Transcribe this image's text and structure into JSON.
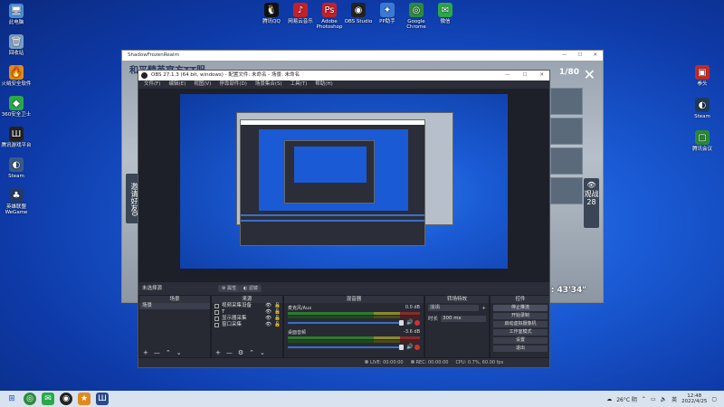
{
  "desktop": {
    "left_icons": [
      {
        "label": "此电脑",
        "glyph": "🖥",
        "color": "#4a90d9"
      },
      {
        "label": "回收站",
        "glyph": "🗑",
        "color": "#7aa0c8"
      },
      {
        "label": "火绒安全软件",
        "glyph": "🔥",
        "color": "#e08a1e"
      },
      {
        "label": "360安全卫士",
        "glyph": "◆",
        "color": "#2aa84a"
      },
      {
        "label": "腾讯游戏平台",
        "glyph": "Ш",
        "color": "#222"
      },
      {
        "label": "Steam",
        "glyph": "◐",
        "color": "#3a5a88"
      },
      {
        "label": "英雄联盟WeGame",
        "glyph": "♣",
        "color": "#233a6b"
      }
    ],
    "top_icons": [
      {
        "label": "腾讯QQ",
        "glyph": "🐧",
        "color": "#111"
      },
      {
        "label": "网易云音乐",
        "glyph": "♪",
        "color": "#c4202a"
      },
      {
        "label": "Adobe Photoshop",
        "glyph": "Ps",
        "color": "#c4202a"
      },
      {
        "label": "OBS Studio",
        "glyph": "◉",
        "color": "#222"
      },
      {
        "label": "PP助手",
        "glyph": "✦",
        "color": "#3a7ad4"
      },
      {
        "label": "Google Chrome",
        "glyph": "◎",
        "color": "#2d8a3f"
      },
      {
        "label": "微信",
        "glyph": "✉",
        "color": "#2aa84a"
      }
    ],
    "right_icons": [
      {
        "label": "拳头",
        "glyph": "▣",
        "color": "#c42a2a"
      },
      {
        "label": "Steam",
        "glyph": "◐",
        "color": "#1f3a5a"
      },
      {
        "label": "腾讯会议",
        "glyph": "▢",
        "color": "#2a8a3a"
      }
    ]
  },
  "game_window": {
    "title": "ShadowFrozenRealm",
    "header_text": "和平精英官方TT服",
    "counter": "1/80",
    "invite_label": "邀请好友",
    "invite_count": "0",
    "spectate_label": "观战",
    "spectate_count": "28",
    "timer": "时 : 43'34\""
  },
  "obs": {
    "title": "OBS 27.1.3 (64 bit, windows) - 配置文件: 未命名 - 场景: 未命名",
    "menu": [
      "文件(F)",
      "编辑(E)",
      "视图(V)",
      "停靠部件(D)",
      "场景集合(S)",
      "工具(T)",
      "帮助(H)"
    ],
    "scene_strip": {
      "label": "未选择源",
      "properties": "属性",
      "filters": "滤镜"
    },
    "scenes": {
      "header": "场景",
      "items": [
        "场景"
      ]
    },
    "sources": {
      "header": "来源",
      "items": [
        {
          "label": "视频采集设备",
          "icon": "camera-icon"
        },
        {
          "label": "T",
          "icon": "text-icon"
        },
        {
          "label": "显示器采集",
          "icon": "monitor-icon"
        },
        {
          "label": "窗口采集",
          "icon": "window-icon"
        }
      ]
    },
    "mixer": {
      "header": "混音器",
      "channels": [
        {
          "name": "麦克风/Aux",
          "db": "0.0 dB"
        },
        {
          "name": "桌面音频",
          "db": "-3.6 dB"
        }
      ]
    },
    "transitions": {
      "header": "转场特效",
      "type": "淡出",
      "duration_label": "时长",
      "duration": "300 ms"
    },
    "controls": {
      "header": "控件",
      "buttons": [
        "停止推流",
        "开始录制",
        "启动虚拟摄像机",
        "工作室模式",
        "设置",
        "退出"
      ]
    },
    "status": {
      "live": "LIVE: 00:00:00",
      "rec": "REC: 00:00:00",
      "cpu": "CPU: 0.7%, 60.00 fps"
    }
  },
  "taskbar": {
    "weather": "26°C 阴",
    "ime": "英",
    "time": "12:48",
    "date": "2022/4/25"
  }
}
